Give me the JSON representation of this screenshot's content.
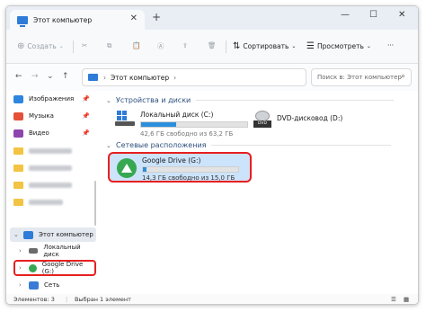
{
  "window": {
    "tab_title": "Этот компьютер",
    "new_tab": "+",
    "minimize": "—",
    "maximize": "☐",
    "close": "✕"
  },
  "toolbar": {
    "create": "Создать",
    "sort": "Сортировать",
    "view": "Просмотреть",
    "more": "···"
  },
  "address": {
    "path": "Этот компьютер",
    "separator": "›",
    "search_placeholder": "Поиск в: Этот компьютер"
  },
  "sidebar": {
    "pinned": [
      {
        "label": "Изображения",
        "icon": "images-icon",
        "color": "#2e86de"
      },
      {
        "label": "Музыка",
        "icon": "music-icon",
        "color": "#e55039"
      },
      {
        "label": "Видео",
        "icon": "video-icon",
        "color": "#8e44ad"
      }
    ],
    "this_pc": "Этот компьютер",
    "local_disk": "Локальный диск",
    "google_drive": "Google Drive (G:)",
    "network": "Сеть"
  },
  "content": {
    "devices_header": "Устройства и диски",
    "network_header": "Сетевые расположения",
    "drives": [
      {
        "name": "Локальный диск (C:)",
        "size": "42,6 ГБ свободно из 63,2 ГБ",
        "fill": 0.33
      },
      {
        "name": "DVD-дисковод (D:)",
        "label": "DVD"
      }
    ],
    "gdrive": {
      "name": "Google Drive (G:)",
      "size": "14,3 ГБ свободно из 15,0 ГБ",
      "fill": 0.04
    }
  },
  "status": {
    "items": "Элементов: 3",
    "selected": "Выбран 1 элемент"
  },
  "colors": {
    "accent": "#2b8fdd",
    "highlight": "#e62020",
    "selection": "#cce4fb"
  }
}
